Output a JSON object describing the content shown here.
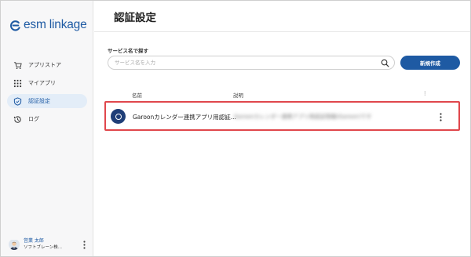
{
  "app": {
    "logo_text": "esm linkage",
    "brand_color": "#1e5aa3"
  },
  "sidebar": {
    "items": [
      {
        "label": "アプリストア",
        "icon": "cart-icon"
      },
      {
        "label": "マイアプリ",
        "icon": "grid-icon"
      },
      {
        "label": "認証設定",
        "icon": "shield-icon",
        "active": true
      },
      {
        "label": "ログ",
        "icon": "history-icon"
      }
    ]
  },
  "user": {
    "name": "営業 太郎",
    "org": "ソフトブレーン株..."
  },
  "page": {
    "title": "認証設定"
  },
  "search": {
    "label": "サービス名で探す",
    "placeholder": "サービス名を入力",
    "value": ""
  },
  "toolbar": {
    "new_button": "新規作成"
  },
  "table": {
    "headers": {
      "name": "名前",
      "description": "説明",
      "menu": "⋮"
    },
    "rows": [
      {
        "name": "Garoonカレンダー連携アプリ用認証...",
        "description": "Garoonカレンダー連携アプリ用認証情報(Garoon)です"
      }
    ]
  },
  "colors": {
    "highlight_border": "#e0474c",
    "primary": "#1e5aa3"
  }
}
